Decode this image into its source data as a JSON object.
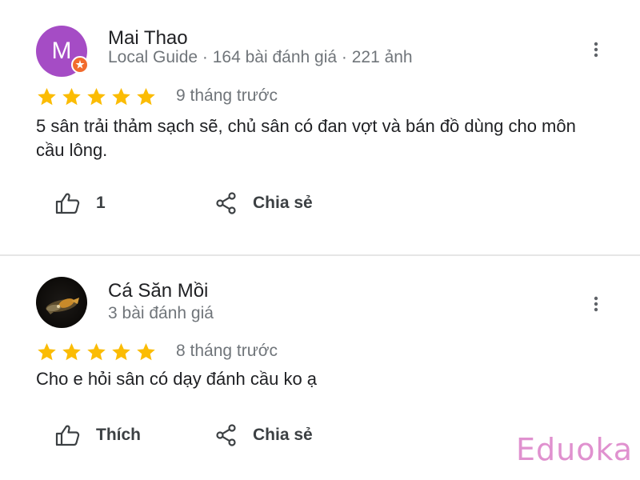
{
  "reviews": [
    {
      "avatar_letter": "M",
      "avatar_color": "#a54cc5",
      "name": "Mai Thao",
      "meta": "Local Guide · 164 bài đánh giá · 221 ảnh",
      "rating": 5,
      "date": "9 tháng trước",
      "text": "5 sân trải thảm sạch sẽ, chủ sân có đan vợt và bán đồ dùng cho môn cầu lông.",
      "like_label": "1",
      "share_label": "Chia sẻ",
      "icons": [
        "more-vert-icon",
        "star-icon",
        "thumb-up-icon",
        "share-icon",
        "local-guide-badge-icon"
      ]
    },
    {
      "name": "Cá Săn Mồi",
      "meta": "3 bài đánh giá",
      "rating": 5,
      "date": "8 tháng trước",
      "text": "Cho e hỏi sân có dạy đánh cầu ko ạ",
      "like_label": "Thích",
      "share_label": "Chia sẻ",
      "icons": [
        "more-vert-icon",
        "star-icon",
        "thumb-up-icon",
        "share-icon"
      ]
    }
  ],
  "colors": {
    "star": "#fbbc04",
    "secondary_text": "#70757a",
    "primary_text": "#202124",
    "watermark": "#e091cf"
  },
  "watermark": "Eduoka"
}
